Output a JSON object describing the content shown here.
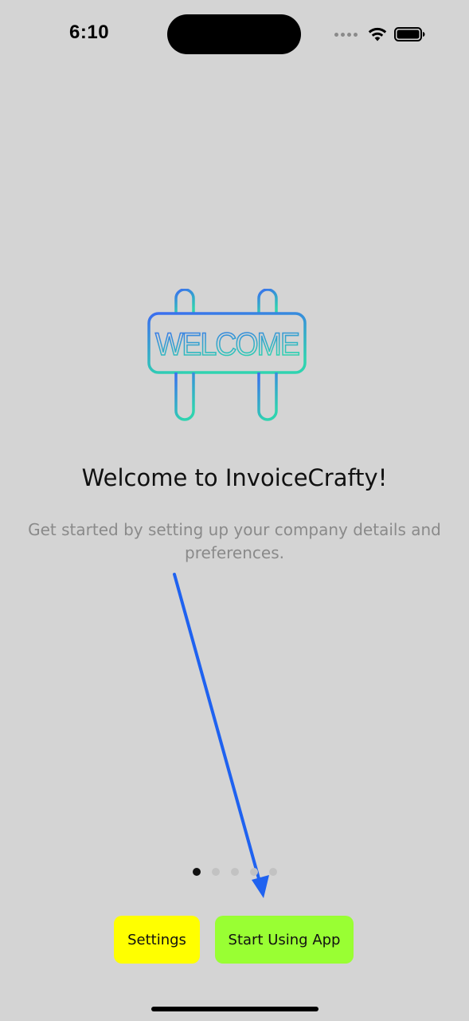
{
  "status_bar": {
    "time": "6:10",
    "icons": [
      "cellular-signal-icon",
      "wifi-icon",
      "battery-icon"
    ]
  },
  "illustration": {
    "sign_text": "WELCOME",
    "gradient_colors": [
      "#3a6df0",
      "#2fd3b0"
    ]
  },
  "onboarding": {
    "title": "Welcome to InvoiceCrafty!",
    "subtitle": "Get started by setting up your company details and preferences.",
    "pages": {
      "count": 5,
      "current": 1
    }
  },
  "buttons": {
    "settings_label": "Settings",
    "start_label": "Start Using App"
  },
  "colors": {
    "background": "#d4d4d4",
    "settings_button": "#ffff00",
    "start_button": "#99ff33",
    "annotation_arrow": "#1f62f0"
  }
}
